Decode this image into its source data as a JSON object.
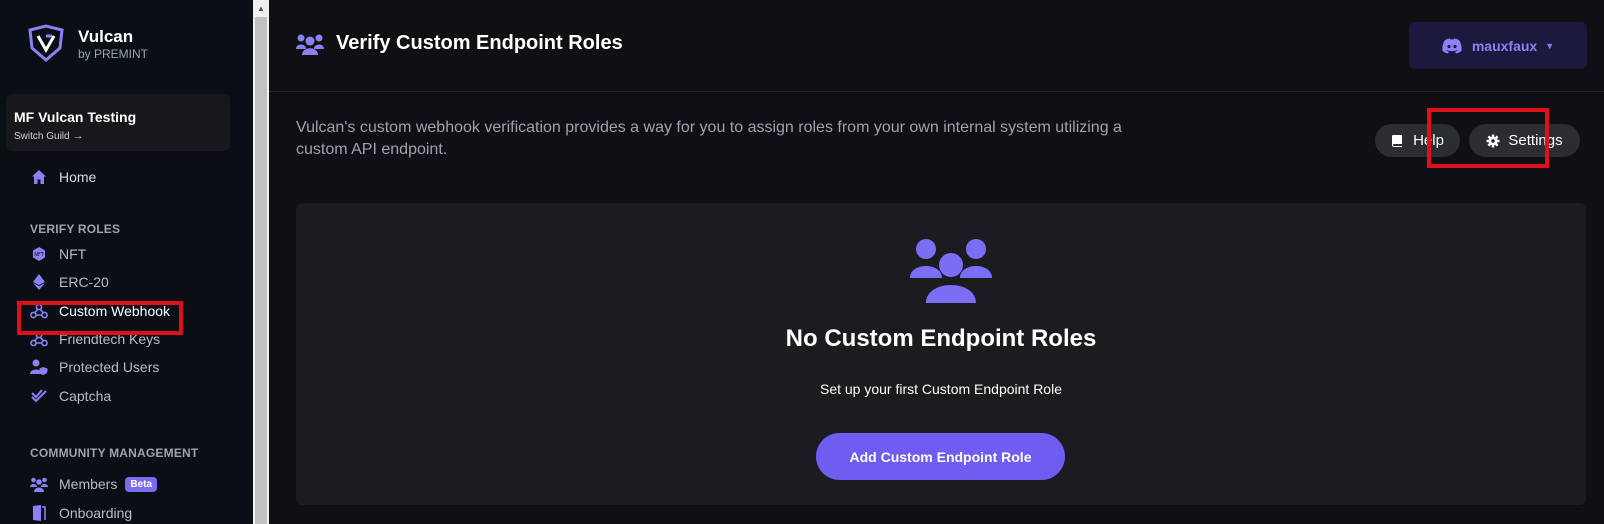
{
  "brand": {
    "name": "Vulcan",
    "sub": "by PREMINT"
  },
  "guild": {
    "name": "MF Vulcan Testing",
    "switch_label": "Switch Guild"
  },
  "nav": {
    "home": "Home",
    "verify_heading": "VERIFY ROLES",
    "verify_items": [
      "NFT",
      "ERC-20",
      "Custom Webhook",
      "Friendtech Keys",
      "Protected Users",
      "Captcha"
    ],
    "community_heading": "COMMUNITY MANAGEMENT",
    "members": "Members",
    "members_badge": "Beta",
    "onboarding": "Onboarding"
  },
  "header": {
    "title": "Verify Custom Endpoint Roles",
    "user": "mauxfaux"
  },
  "description": "Vulcan's custom webhook verification provides a way for you to assign roles from your own internal system utilizing a custom API endpoint.",
  "buttons": {
    "help": "Help",
    "settings": "Settings"
  },
  "empty_state": {
    "title": "No Custom Endpoint Roles",
    "subtitle": "Set up your first Custom Endpoint Role",
    "action": "Add Custom Endpoint Role"
  },
  "colors": {
    "accent": "#6f5cf0",
    "highlight": "#e0101a",
    "sidebar_bg": "#0a0f16",
    "main_bg": "#101014"
  },
  "icons": {
    "home": "home-icon",
    "nft": "nft-icon",
    "erc20": "ethereum-icon",
    "webhook": "webhook-icon",
    "friendtech": "webhook-icon",
    "protected": "user-shield-icon",
    "captcha": "double-check-icon",
    "members": "users-icon",
    "onboarding": "door-icon",
    "discord": "discord-icon",
    "help": "book-icon",
    "settings": "gear-icon"
  }
}
